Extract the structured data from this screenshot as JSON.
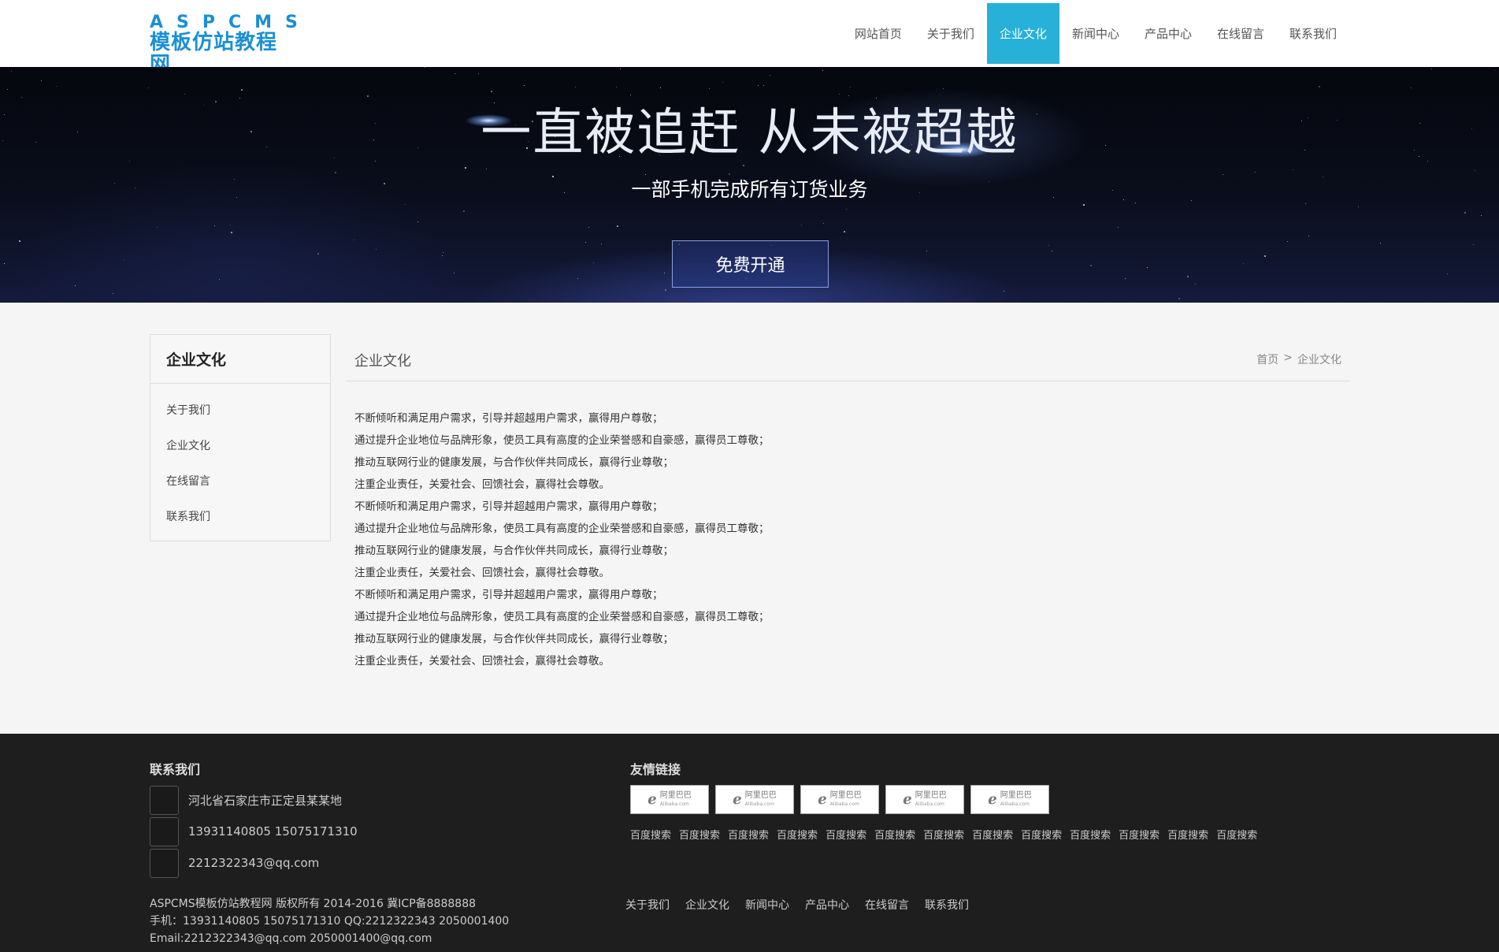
{
  "header": {
    "logo_top": "ASPCMS",
    "logo_bottom": "模板仿站教程网",
    "nav": [
      "网站首页",
      "关于我们",
      "企业文化",
      "新闻中心",
      "产品中心",
      "在线留言",
      "联系我们"
    ],
    "active_nav": "企业文化",
    "accent_color": "#27b0d8"
  },
  "banner": {
    "title": "一直被追赶 从未被超越",
    "subtitle": "一部手机完成所有订货业务",
    "button": "免费开通"
  },
  "sidebar": {
    "title": "企业文化",
    "items": [
      "关于我们",
      "企业文化",
      "在线留言",
      "联系我们"
    ]
  },
  "main": {
    "title": "企业文化",
    "breadcrumb": {
      "home": "首页",
      "separator": ">",
      "current": "企业文化"
    },
    "paragraphs": [
      "不断倾听和满足用户需求，引导并超越用户需求，赢得用户尊敬；",
      "通过提升企业地位与品牌形象，使员工具有高度的企业荣誉感和自豪感，赢得员工尊敬；",
      "推动互联网行业的健康发展，与合作伙伴共同成长，赢得行业尊敬；",
      "注重企业责任，关爱社会、回馈社会，赢得社会尊敬。",
      "不断倾听和满足用户需求，引导并超越用户需求，赢得用户尊敬；",
      "通过提升企业地位与品牌形象，使员工具有高度的企业荣誉感和自豪感，赢得员工尊敬；",
      "推动互联网行业的健康发展，与合作伙伴共同成长，赢得行业尊敬；",
      "注重企业责任，关爱社会、回馈社会，赢得社会尊敬。",
      "不断倾听和满足用户需求，引导并超越用户需求，赢得用户尊敬；",
      "通过提升企业地位与品牌形象，使员工具有高度的企业荣誉感和自豪感，赢得员工尊敬；",
      "推动互联网行业的健康发展，与合作伙伴共同成长，赢得行业尊敬；",
      "注重企业责任，关爱社会、回馈社会，赢得社会尊敬。"
    ]
  },
  "footer": {
    "contact_heading": "联系我们",
    "address": "河北省石家庄市正定县某某地",
    "phones": "13931140805 15075171310",
    "email": "2212322343@qq.com",
    "links_heading": "友情链接",
    "partner_logos": [
      {
        "cn": "阿里巴巴",
        "en": "Alibaba.com"
      },
      {
        "cn": "阿里巴巴",
        "en": "Alibaba.com"
      },
      {
        "cn": "阿里巴巴",
        "en": "Alibaba.com"
      },
      {
        "cn": "阿里巴巴",
        "en": "Alibaba.com"
      },
      {
        "cn": "阿里巴巴",
        "en": "Alibaba.com"
      }
    ],
    "friend_links": [
      "百度搜索",
      "百度搜索",
      "百度搜索",
      "百度搜索",
      "百度搜索",
      "百度搜索",
      "百度搜索",
      "百度搜索",
      "百度搜索",
      "百度搜索",
      "百度搜索",
      "百度搜索",
      "百度搜索"
    ],
    "copyright_lines": [
      "ASPCMS模板仿站教程网 版权所有 2014-2016 冀ICP备8888888",
      "手机：13931140805 15075171310 QQ:2212322343 2050001400",
      "Email:2212322343@qq.com 2050001400@qq.com"
    ],
    "bottom_nav": [
      "关于我们",
      "企业文化",
      "新闻中心",
      "产品中心",
      "在线留言",
      "联系我们"
    ]
  }
}
